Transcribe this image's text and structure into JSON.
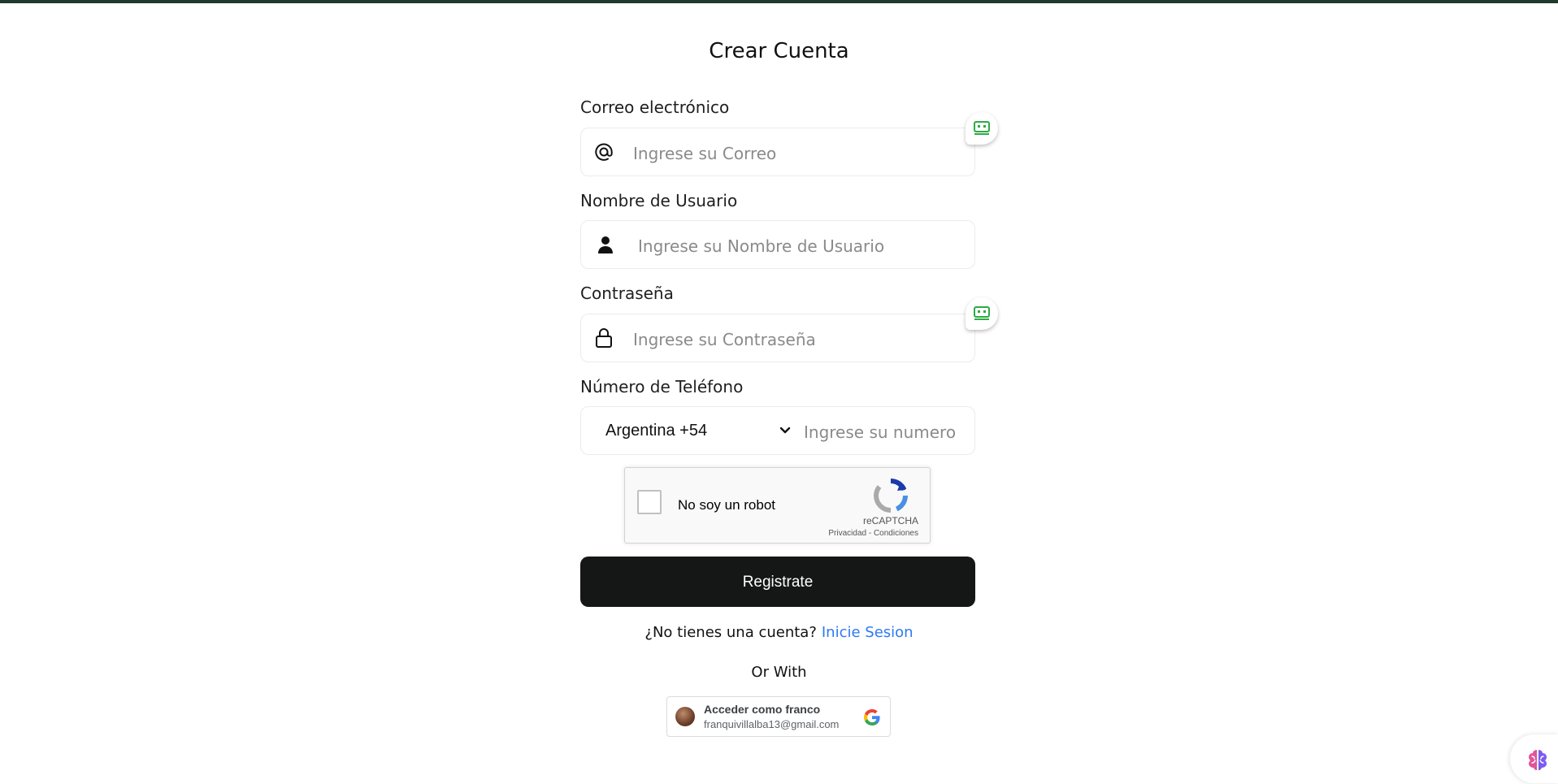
{
  "page": {
    "title": "Crear Cuenta"
  },
  "form": {
    "email": {
      "label": "Correo electrónico",
      "placeholder": "Ingrese su Correo",
      "value": ""
    },
    "username": {
      "label": "Nombre de Usuario",
      "placeholder": "Ingrese su Nombre de Usuario",
      "value": ""
    },
    "password": {
      "label": "Contraseña",
      "placeholder": "Ingrese su Contraseña",
      "value": ""
    },
    "phone": {
      "label": "Número de Teléfono",
      "country_selected": "Argentina +54",
      "placeholder": "Ingrese su numero",
      "value": ""
    }
  },
  "captcha": {
    "label": "No soy un robot",
    "brand": "reCAPTCHA",
    "terms": "Privacidad - Condiciones",
    "checked": false
  },
  "register_button": {
    "label": "Registrate"
  },
  "account_prompt": {
    "text": "¿No tienes una cuenta?",
    "link": "Inicie Sesion"
  },
  "or_with": "Or With",
  "google_signin": {
    "name": "Acceder como franco",
    "email": "franquivillalba13@gmail.com"
  },
  "colors": {
    "topbar": "#1f3a2c",
    "button_bg": "#151717",
    "link": "#2d79f3",
    "manager_badge_green": "#2eaa44"
  },
  "icons": [
    "at-icon",
    "user-icon",
    "lock-icon",
    "chevron-down-icon",
    "password-manager-icon",
    "recaptcha-icon",
    "google-icon",
    "brain-extension-icon"
  ]
}
